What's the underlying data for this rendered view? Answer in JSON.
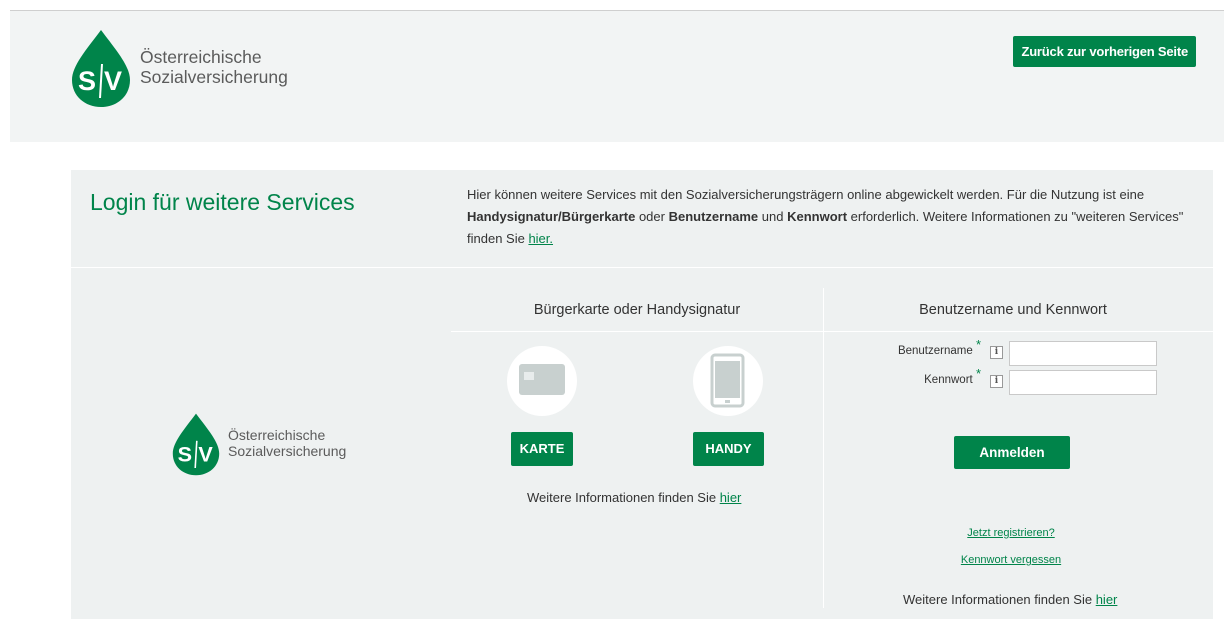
{
  "brand": {
    "line1": "Österreichische",
    "line2": "Sozialversicherung",
    "logo_letters": "SV",
    "color": "#00844a"
  },
  "header": {
    "back_button": "Zurück zur vorherigen Seite"
  },
  "login": {
    "title": "Login für weitere Services",
    "intro": {
      "p1": "Hier können weitere Services mit den Sozialversicherungsträgern online abgewickelt werden. Für die Nutzung ist eine ",
      "b1": "Handysignatur/Bürgerkarte",
      "p2": " oder ",
      "b2": "Benutzername",
      "p3": " und ",
      "b3": "Kennwort",
      "p4": " erforderlich. Weitere Informationen zu \"weiteren Services\" finden Sie ",
      "link": "hier."
    }
  },
  "card_section": {
    "heading": "Bürgerkarte oder Handysignatur",
    "card_icon": "card-icon",
    "phone_icon": "smartphone-icon",
    "card_button": "KARTE",
    "phone_button": "HANDY",
    "more_text": "Weitere Informationen finden Sie ",
    "more_link": "hier"
  },
  "credentials": {
    "heading": "Benutzername und Kennwort",
    "username_label": "Benutzername",
    "password_label": "Kennwort",
    "required_mark": "*",
    "info_icon": "i",
    "username_value": "",
    "password_value": "",
    "submit": "Anmelden",
    "register_link": "Jetzt registrieren?",
    "forgot_link": "Kennwort vergessen",
    "more_text": "Weitere Informationen finden Sie ",
    "more_link": "hier"
  }
}
